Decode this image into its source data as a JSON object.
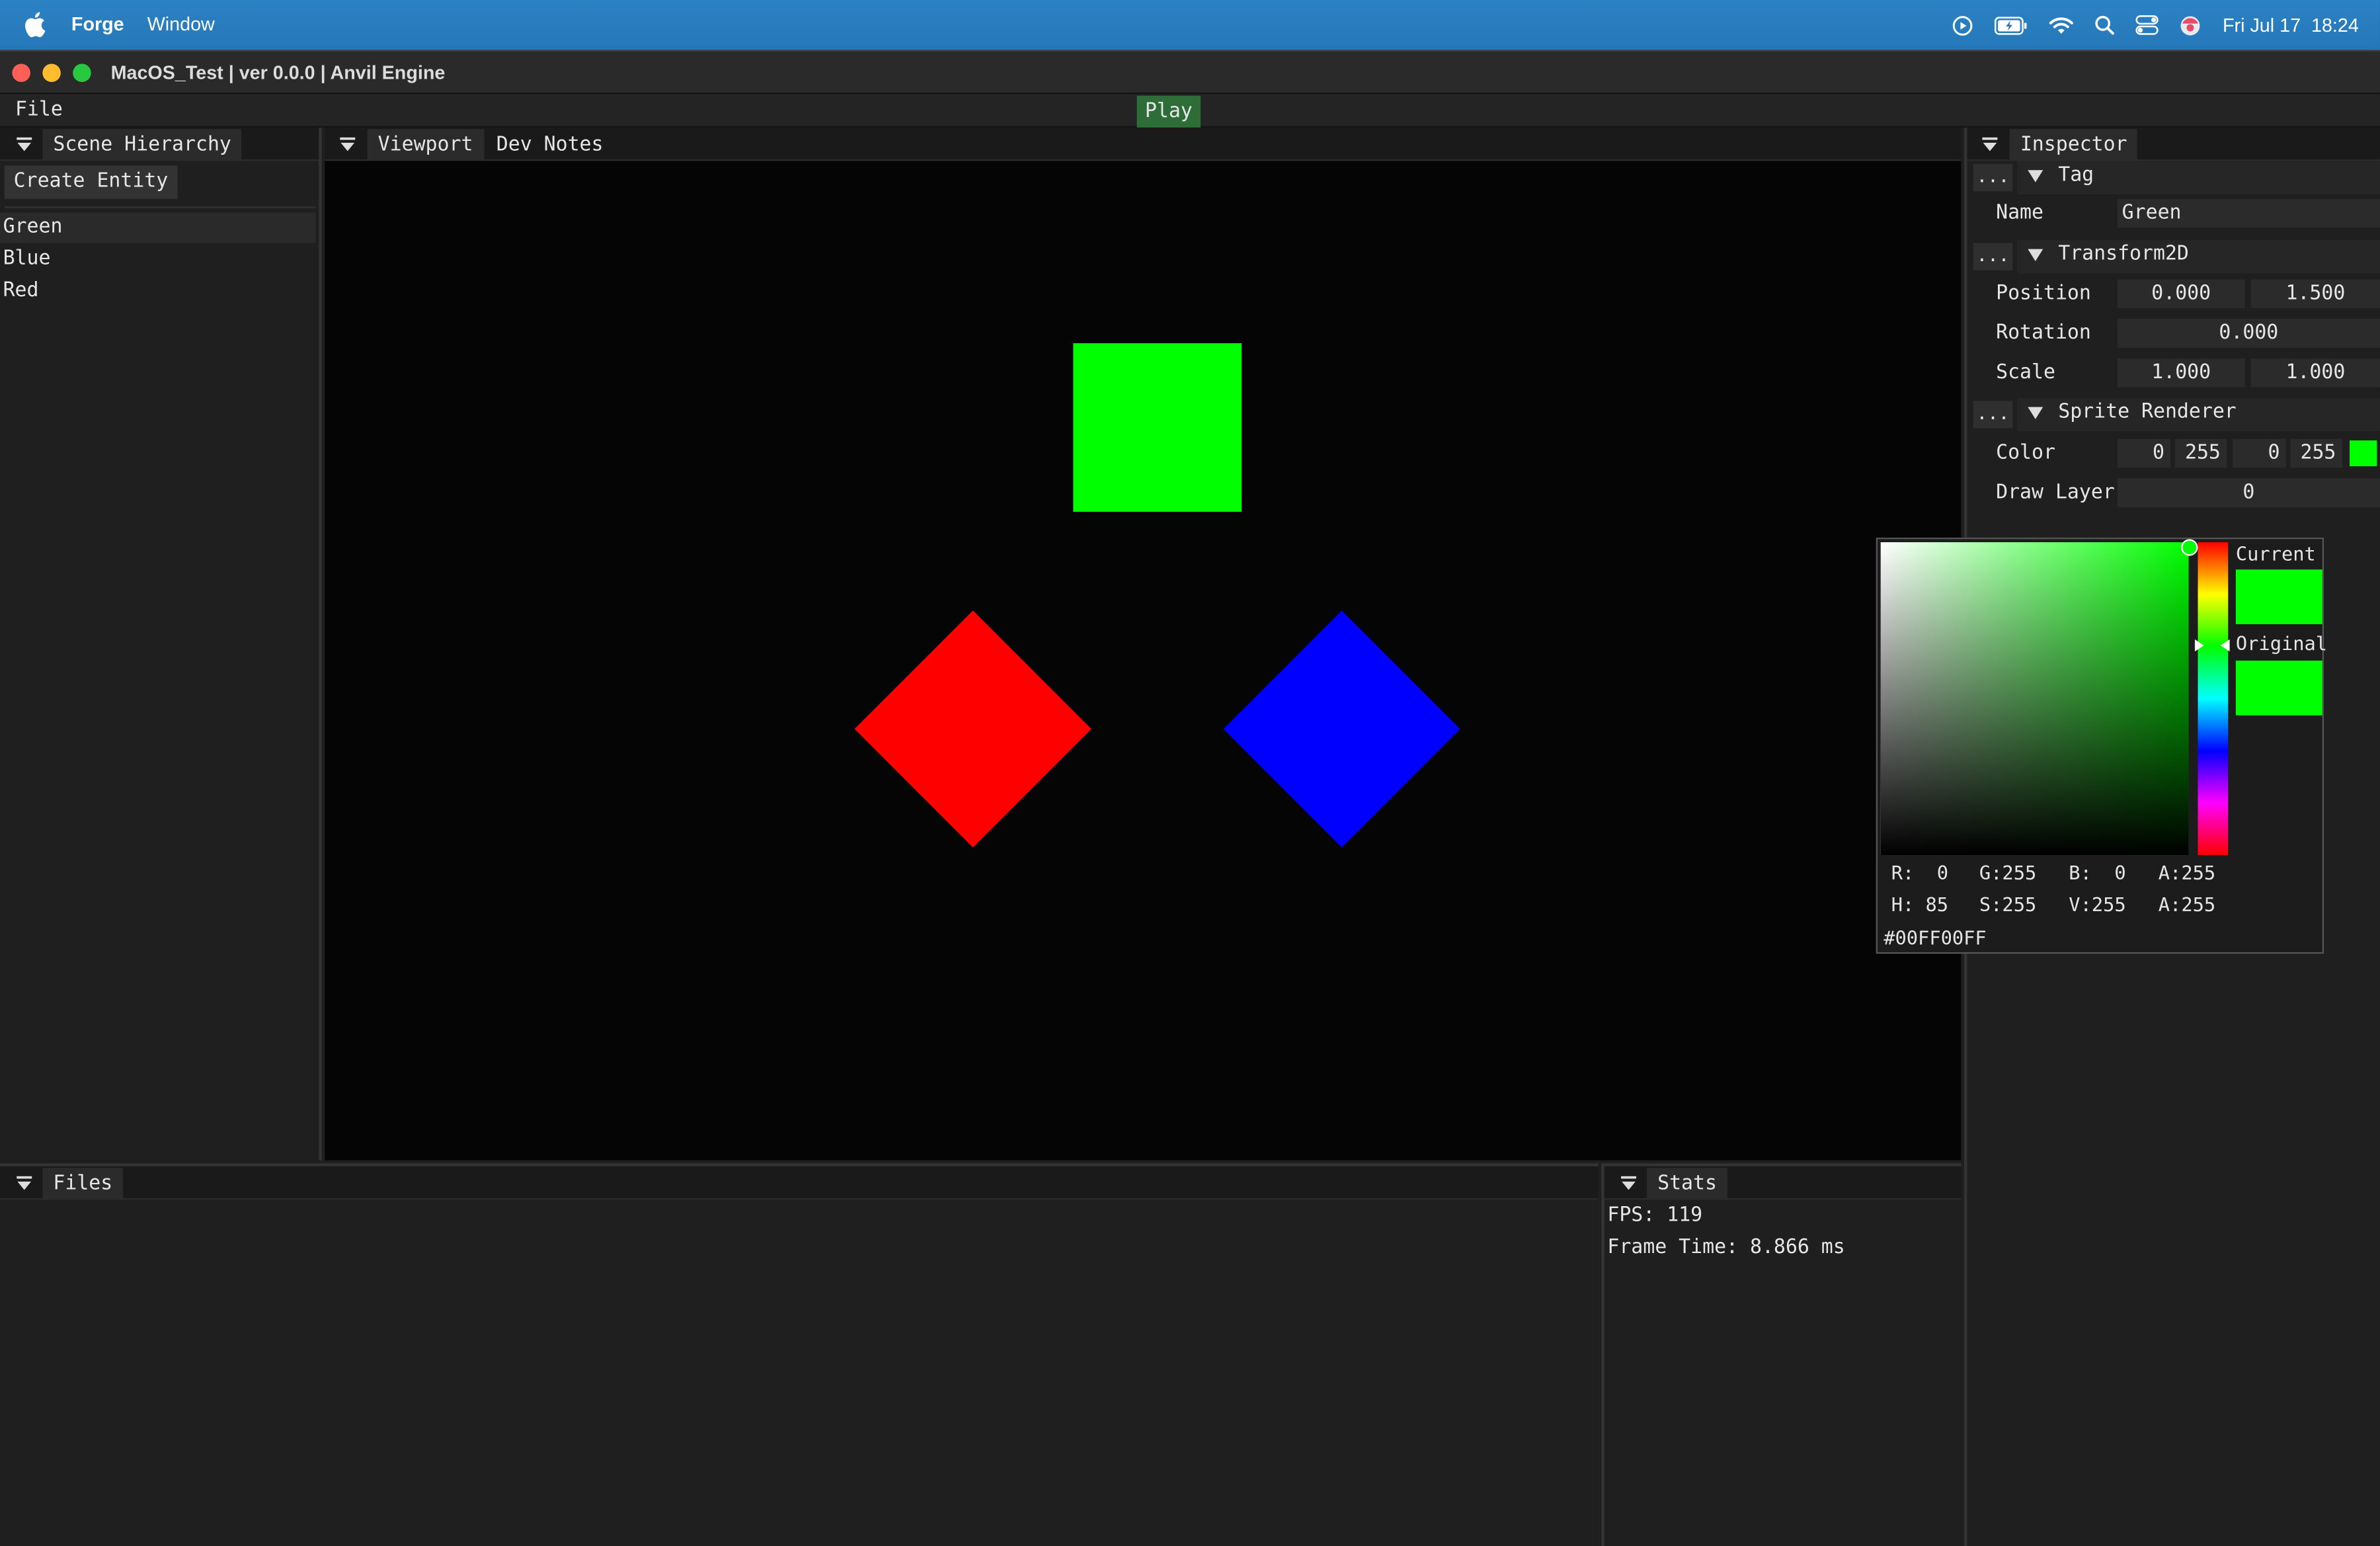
{
  "menubar": {
    "app_name": "Forge",
    "menu_window": "Window",
    "clock": "Fri Jul 17  18:24",
    "status_icons": [
      "play-circle-icon",
      "battery-icon",
      "wifi-icon",
      "search-icon",
      "control-center-icon",
      "user-avatar-icon"
    ]
  },
  "window": {
    "title": "MacOS_Test | ver 0.0.0 | Anvil Engine"
  },
  "app_menu": {
    "file": "File",
    "play": "Play"
  },
  "hierarchy": {
    "tab": "Scene Hierarchy",
    "create_button": "Create Entity",
    "entities": [
      "Green",
      "Blue",
      "Red"
    ],
    "selected": "Green"
  },
  "viewport": {
    "tabs": [
      "Viewport",
      "Dev Notes"
    ],
    "active_tab": "Viewport",
    "entities": [
      {
        "name": "Green",
        "shape": "square",
        "color": "#00ff00"
      },
      {
        "name": "Red",
        "shape": "diamond",
        "color": "#ff0000"
      },
      {
        "name": "Blue",
        "shape": "diamond",
        "color": "#0000ff"
      }
    ]
  },
  "inspector": {
    "tab": "Inspector",
    "dots": "...",
    "tag": {
      "title": "Tag",
      "name_label": "Name",
      "name_value": "Green"
    },
    "transform": {
      "title": "Transform2D",
      "position_label": "Position",
      "position_x": "0.000",
      "position_y": "1.500",
      "rotation_label": "Rotation",
      "rotation": "0.000",
      "scale_label": "Scale",
      "scale_x": "1.000",
      "scale_y": "1.000"
    },
    "sprite": {
      "title": "Sprite Renderer",
      "color_label": "Color",
      "r": "0",
      "g": "255",
      "b": "0",
      "a": "255",
      "swatch_color": "#00ff00",
      "draw_layer_label": "Draw Layer",
      "draw_layer": "0"
    }
  },
  "color_picker": {
    "current_label": "Current",
    "original_label": "Original",
    "current_color": "#00ff00",
    "original_color": "#00ff00",
    "rgba": {
      "r": "R:  0",
      "g": "G:255",
      "b": "B:  0",
      "a": "A:255"
    },
    "hsva": {
      "h": "H: 85",
      "s": "S:255",
      "v": "V:255",
      "a": "A:255"
    },
    "hex": "#00FF00FF"
  },
  "files": {
    "tab": "Files"
  },
  "stats": {
    "tab": "Stats",
    "fps": "FPS: 119",
    "frame_time": "Frame Time: 8.866 ms"
  }
}
